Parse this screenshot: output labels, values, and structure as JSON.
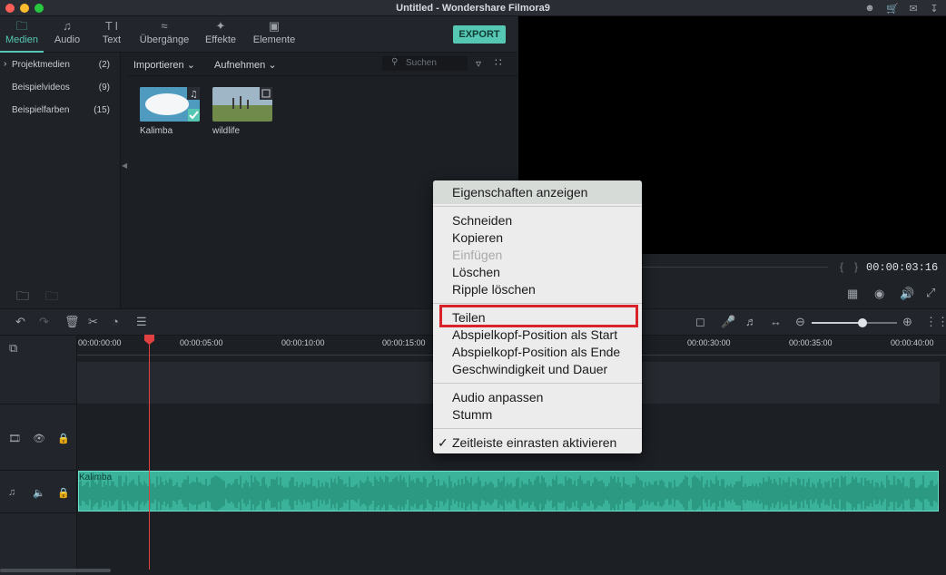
{
  "window": {
    "title": "Untitled - Wondershare Filmora9"
  },
  "tabs": [
    {
      "label": "Medien",
      "icon": "folder-icon"
    },
    {
      "label": "Audio",
      "icon": "music-note-icon"
    },
    {
      "label": "Text",
      "icon": "text-icon"
    },
    {
      "label": "Übergänge",
      "icon": "transition-icon"
    },
    {
      "label": "Effekte",
      "icon": "effects-icon"
    },
    {
      "label": "Elemente",
      "icon": "image-icon"
    }
  ],
  "export_label": "EXPORT",
  "sidebar": {
    "items": [
      {
        "label": "Projektmedien",
        "count": "(2)"
      },
      {
        "label": "Beispielvideos",
        "count": "(9)"
      },
      {
        "label": "Beispielfarben",
        "count": "(15)"
      }
    ]
  },
  "browser": {
    "import_label": "Importieren",
    "record_label": "Aufnehmen",
    "search_placeholder": "Suchen",
    "media": [
      {
        "label": "Kalimba",
        "type": "audio"
      },
      {
        "label": "wildlife",
        "type": "video"
      }
    ]
  },
  "preview": {
    "time": "00:00:03:16"
  },
  "timeline": {
    "ticks": [
      "00:00:00:00",
      "00:00:05:00",
      "00:00:10:00",
      "00:00:15:00",
      "00:00:30:00",
      "00:00:35:00",
      "00:00:40:00"
    ],
    "audio_clip_label": "Kalimba",
    "zoom_level": 0.6
  },
  "context_menu": {
    "items": [
      {
        "label": "Eigenschaften anzeigen"
      },
      {
        "label": "Schneiden"
      },
      {
        "label": "Kopieren"
      },
      {
        "label": "Einfügen",
        "disabled": true
      },
      {
        "label": "Löschen"
      },
      {
        "label": "Ripple löschen"
      },
      {
        "label": "Teilen",
        "highlighted": true
      },
      {
        "label": "Abspielkopf-Position als Start"
      },
      {
        "label": "Abspielkopf-Position als Ende"
      },
      {
        "label": "Geschwindigkeit und Dauer"
      },
      {
        "label": "Audio anpassen"
      },
      {
        "label": "Stumm"
      },
      {
        "label": "Zeitleiste einrasten aktivieren",
        "checked": true
      }
    ]
  },
  "colors": {
    "accent": "#56c7b3",
    "highlight_box": "#d8232a",
    "playhead": "#e04040"
  }
}
